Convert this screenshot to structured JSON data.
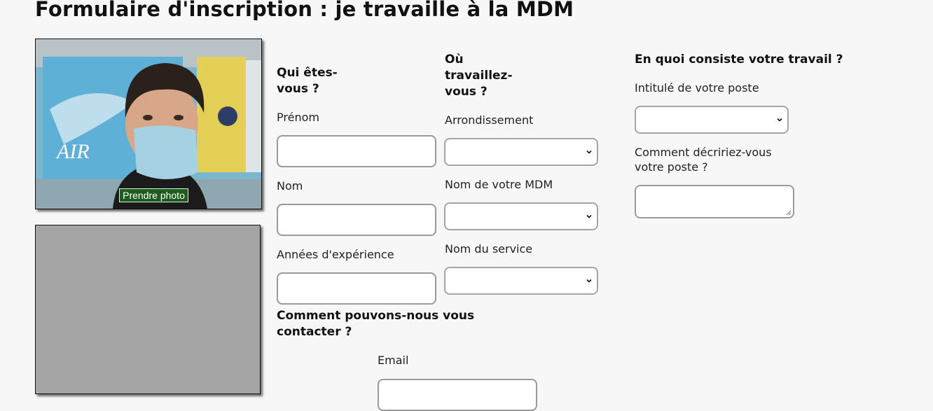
{
  "page": {
    "title": "Formulaire d'inscription : je travaille à la MDM"
  },
  "camera": {
    "take_photo_label": "Prendre photo"
  },
  "who": {
    "heading": "Qui êtes-vous ?",
    "first_name_label": "Prénom",
    "last_name_label": "Nom",
    "experience_label": "Années d'expérience"
  },
  "where": {
    "heading": "Où travaillez-vous ?",
    "district_label": "Arrondissement",
    "mdm_label": "Nom de votre MDM",
    "service_label": "Nom du service"
  },
  "work": {
    "heading": "En quoi consiste votre travail ?",
    "job_title_label": "Intitulé de votre poste",
    "job_desc_label": "Comment décririez-vous votre poste ?"
  },
  "contact": {
    "heading": "Comment pouvons-nous vous contacter ?",
    "email_label": "Email"
  },
  "icons": {
    "select_arrow": "chevron-down-icon",
    "resize": "resize-grip-icon"
  }
}
